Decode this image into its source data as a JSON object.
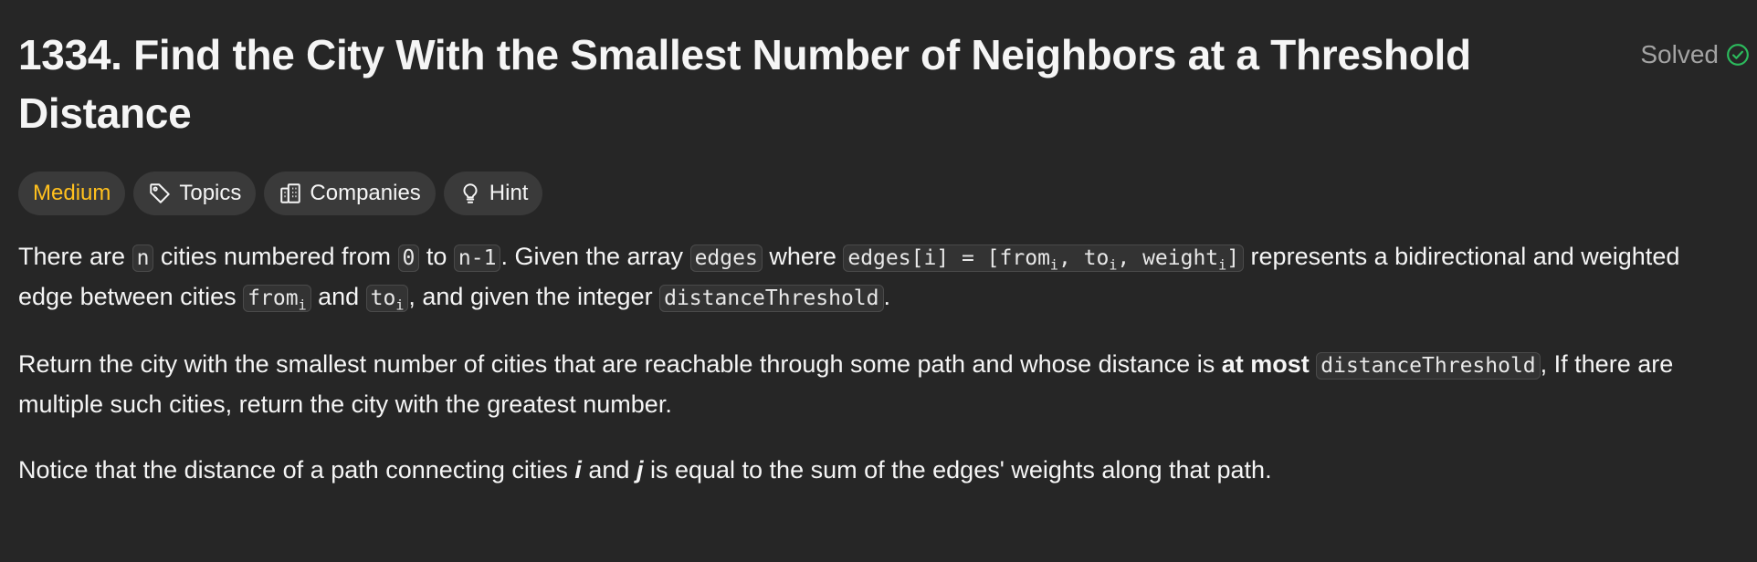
{
  "problem": {
    "title": "1334. Find the City With the Smallest Number of Neighbors at a Threshold Distance",
    "status": "Solved",
    "difficulty": "Medium",
    "tags": {
      "topics": "Topics",
      "companies": "Companies",
      "hint": "Hint"
    }
  },
  "colors": {
    "background": "#262626",
    "medium": "#ffc01e",
    "solved_check": "#2cbb5d"
  },
  "icons": [
    "check-circle-icon",
    "tag-icon",
    "building-icon",
    "lightbulb-icon"
  ],
  "description": {
    "p1": {
      "t1": "There are ",
      "c1": "n",
      "t2": " cities numbered from ",
      "c2": "0",
      "t3": " to ",
      "c3": "n-1",
      "t4": ". Given the array ",
      "c4": "edges",
      "t5": " where ",
      "c5a": "edges[i] = [from",
      "c5s1": "i",
      "c5b": ", to",
      "c5s2": "i",
      "c5c": ", weight",
      "c5s3": "i",
      "c5d": "]",
      "t6": " represents a bidirectional and weighted edge between cities ",
      "c6a": "from",
      "c6s": "i",
      "t7": " and ",
      "c7a": "to",
      "c7s": "i",
      "t8": ", and given the integer ",
      "c8": "distanceThreshold",
      "t9": "."
    },
    "p2": {
      "t1": "Return the city with the smallest number of cities that are reachable through some path and whose distance is ",
      "b1": "at most",
      "t2": " ",
      "c1": "distanceThreshold",
      "t3": ", If there are multiple such cities, return the city with the greatest number."
    },
    "p3": {
      "t1": "Notice that the distance of a path connecting cities ",
      "i1": "i",
      "t2": " and ",
      "i2": "j",
      "t3": " is equal to the sum of the edges' weights along that path."
    }
  }
}
